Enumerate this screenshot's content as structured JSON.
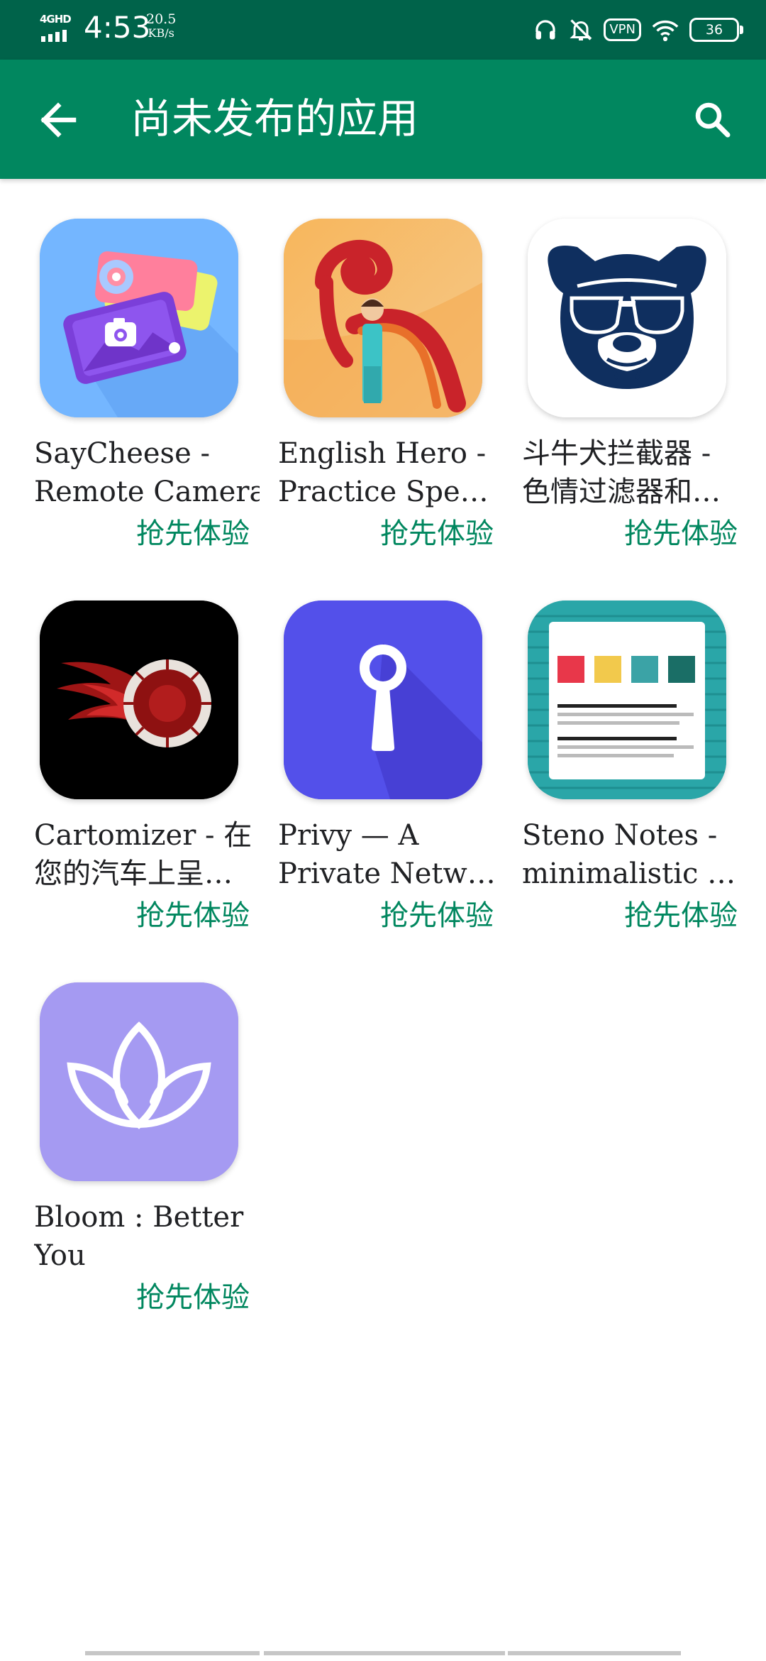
{
  "status_bar": {
    "network": "4GHD",
    "time": "4:53",
    "speed_value": "20.5",
    "speed_unit": "KB/s",
    "vpn": "VPN",
    "battery": "36"
  },
  "app_bar": {
    "title": "尚未发布的应用",
    "back_icon": "arrow-back-icon",
    "search_icon": "search-icon",
    "color": "#01875f"
  },
  "apps": [
    {
      "name_line1": "SayCheese -",
      "name_line2": "Remote Camera",
      "badge": "抢先体验",
      "icon": "camera-photos-icon"
    },
    {
      "name_line1": "English Hero -",
      "name_line2": "Practice Spe…",
      "badge": "抢先体验",
      "icon": "hero-letter-icon"
    },
    {
      "name_line1": "斗牛犬拦截器 -",
      "name_line2": "色情过滤器和…",
      "badge": "抢先体验",
      "icon": "bulldog-sunglasses-icon"
    },
    {
      "name_line1": "Cartomizer - 在",
      "name_line2": "您的汽车上呈…",
      "badge": "抢先体验",
      "icon": "flaming-tire-icon"
    },
    {
      "name_line1": "Privy — A",
      "name_line2": "Private Netw…",
      "badge": "抢先体验",
      "icon": "keyhole-icon"
    },
    {
      "name_line1": "Steno Notes -",
      "name_line2": "minimalistic …",
      "badge": "抢先体验",
      "icon": "notes-document-icon"
    },
    {
      "name_line1": "Bloom : Better",
      "name_line2": "You",
      "badge": "抢先体验",
      "icon": "lotus-icon"
    }
  ],
  "colors": {
    "status_bar": "#00634a",
    "accent": "#01875f",
    "text": "#202124"
  }
}
